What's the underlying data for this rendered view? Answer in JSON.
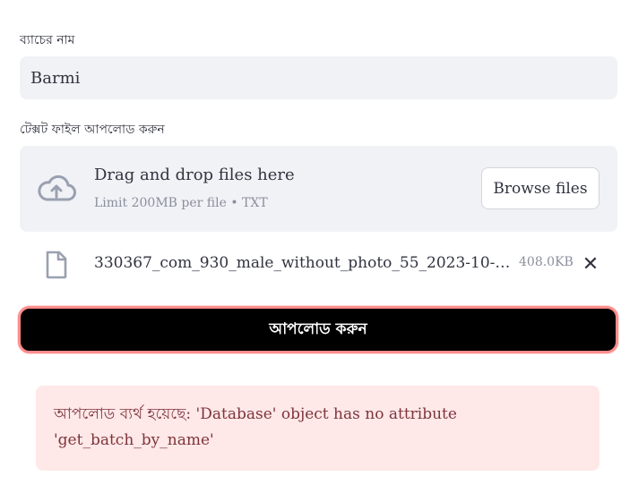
{
  "batch_name": {
    "label": "ব্যাচের নাম",
    "value": "Barmi"
  },
  "file_upload": {
    "label": "টেক্সট ফাইল আপলোড করুন",
    "dropzone_title": "Drag and drop files here",
    "dropzone_subtitle": "Limit 200MB per file • TXT",
    "browse_label": "Browse files",
    "icon": "cloud-upload-icon"
  },
  "uploaded_file": {
    "name": "330367_com_930_male_without_photo_55_2023-10-1...",
    "size": "408.0KB",
    "remove_glyph": "✕",
    "icon": "file-icon"
  },
  "upload_button": {
    "label": "আপলোড করুন"
  },
  "error": {
    "message": "আপলোড ব্যর্থ হয়েছে: 'Database' object has no attribute 'get_batch_by_name'"
  },
  "colors": {
    "input_bg": "#f0f2f6",
    "button_bg": "#000000",
    "button_border": "#ff8c8c",
    "error_bg": "#ffe8e8",
    "error_text": "#7d353b"
  }
}
